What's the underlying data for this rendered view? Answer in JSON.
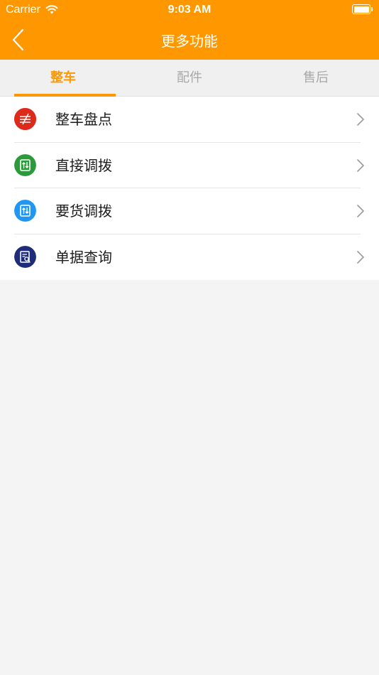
{
  "status_bar": {
    "carrier": "Carrier",
    "time": "9:03 AM"
  },
  "nav": {
    "title": "更多功能",
    "back_icon": "chevron-left-icon"
  },
  "tabs": [
    {
      "label": "整车",
      "active": true
    },
    {
      "label": "配件",
      "active": false
    },
    {
      "label": "售后",
      "active": false
    }
  ],
  "menu": [
    {
      "label": "整车盘点",
      "icon": "inventory-icon",
      "icon_color": "#dd2a1b"
    },
    {
      "label": "直接调拨",
      "icon": "transfer-icon",
      "icon_color": "#2c9a3a"
    },
    {
      "label": "要货调拨",
      "icon": "request-transfer-icon",
      "icon_color": "#2196f3"
    },
    {
      "label": "单据查询",
      "icon": "document-search-icon",
      "icon_color": "#1f2c7a"
    }
  ],
  "colors": {
    "accent": "#ff9800",
    "background": "#f4f4f4"
  }
}
